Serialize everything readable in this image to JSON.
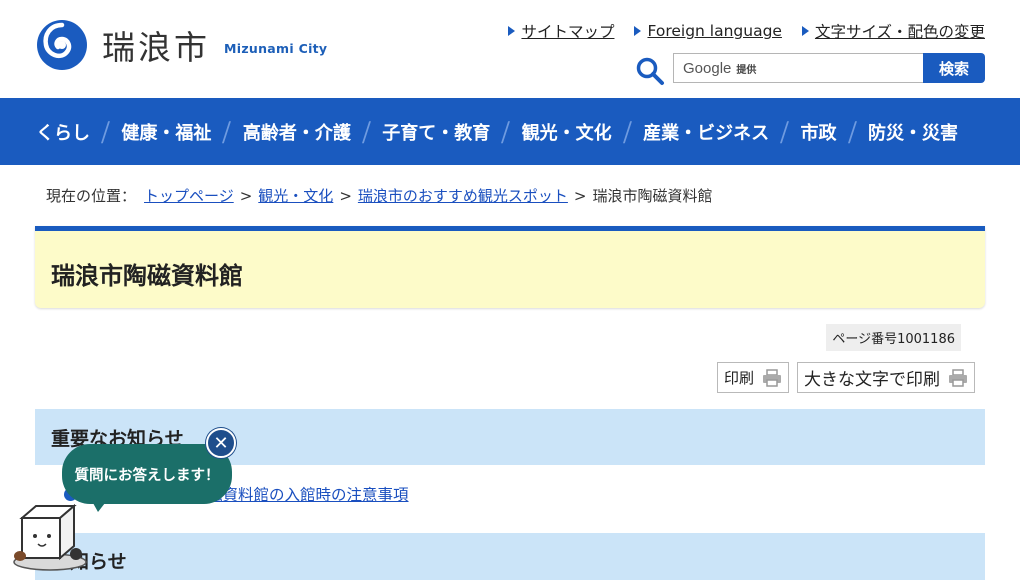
{
  "header": {
    "logo_text": "瑞浪市",
    "logo_sub": "Mizunami City",
    "util_links": [
      "サイトマップ",
      "Foreign language",
      "文字サイズ・配色の変更"
    ],
    "search": {
      "google_label": "Google",
      "provided_label": "提供",
      "button_label": "検索"
    }
  },
  "nav": {
    "items": [
      "くらし",
      "健康・福祉",
      "高齢者・介護",
      "子育て・教育",
      "観光・文化",
      "産業・ビジネス",
      "市政",
      "防災・災害"
    ]
  },
  "breadcrumb": {
    "here_label": "現在の位置：",
    "links": [
      "トップページ",
      "観光・文化",
      "瑞浪市のおすすめ観光スポット"
    ],
    "current": "瑞浪市陶磁資料館",
    "separator": ">"
  },
  "page": {
    "title": "瑞浪市陶磁資料館",
    "page_number": "ページ番号1001186",
    "print_label": "印刷",
    "print_large_label": "大きな文字で印刷"
  },
  "sections": {
    "important": {
      "heading": "重要なお知らせ",
      "item_link": "【重要】瑞浪市陶磁資料館の入館時の注意事項"
    },
    "news": {
      "heading": "お知らせ"
    }
  },
  "chat": {
    "bubble_text": "質問にお答えします！",
    "close_symbol": "✕"
  },
  "colors": {
    "brand_blue": "#1a5bbf",
    "title_bg": "#fdfbc9",
    "section_bg": "#cbe4f8",
    "chat_green": "#1b6f69"
  }
}
